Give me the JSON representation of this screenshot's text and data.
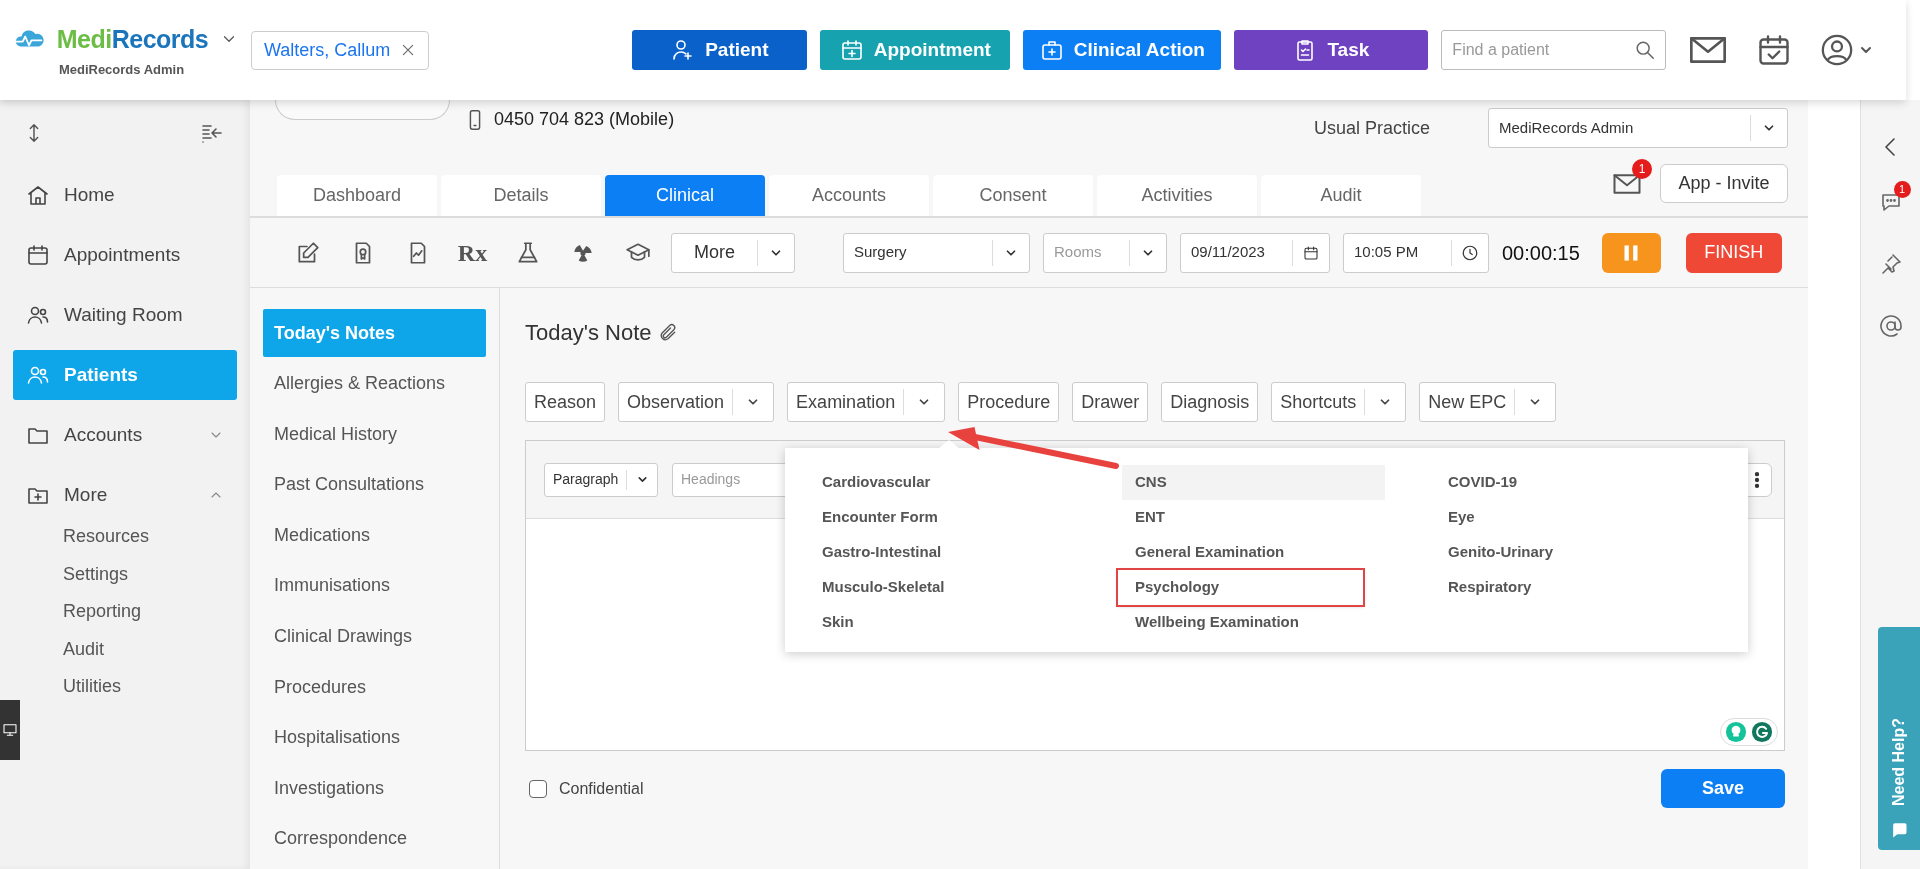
{
  "header": {
    "brand_parts": [
      "Medi",
      "Records"
    ],
    "practice": "MediRecords Admin",
    "patient_chip": "Walters, Callum",
    "actions": [
      {
        "kind": "patient",
        "label": "Patient"
      },
      {
        "kind": "appointment",
        "label": "Appointment"
      },
      {
        "kind": "clinical",
        "label": "Clinical Action"
      },
      {
        "kind": "task",
        "label": "Task"
      }
    ],
    "search": {
      "placeholder": "Find a patient"
    }
  },
  "sidebar": {
    "items": [
      {
        "kind": "link",
        "label": "Home",
        "selected": false
      },
      {
        "kind": "link",
        "label": "Appointments",
        "selected": false
      },
      {
        "kind": "link",
        "label": "Waiting Room",
        "selected": false
      },
      {
        "kind": "link",
        "label": "Patients",
        "selected": true
      },
      {
        "kind": "group",
        "label": "Accounts",
        "selected": false,
        "expanded": false
      },
      {
        "kind": "group",
        "label": "More",
        "selected": false,
        "expanded": true,
        "children": [
          {
            "label": "Resources",
            "selected": false
          },
          {
            "label": "Settings",
            "selected": false
          },
          {
            "label": "Reporting",
            "selected": false
          },
          {
            "label": "Audit",
            "selected": false
          },
          {
            "label": "Utilities",
            "selected": false
          }
        ]
      }
    ]
  },
  "patient": {
    "phone": "0450 704 823 (Mobile)",
    "usual_practice_label": "Usual Practice",
    "usual_practice": "MediRecords Admin",
    "messages_count": "1",
    "invite_button": "App - Invite"
  },
  "tabs": [
    {
      "label": "Dashboard",
      "selected": false
    },
    {
      "label": "Details",
      "selected": false
    },
    {
      "label": "Clinical",
      "selected": true
    },
    {
      "label": "Accounts",
      "selected": false
    },
    {
      "label": "Consent",
      "selected": false
    },
    {
      "label": "Activities",
      "selected": false
    },
    {
      "label": "Audit",
      "selected": false
    }
  ],
  "toolbar": {
    "prescription_label": "Rx",
    "more_button": "More",
    "location": "Surgery",
    "rooms_placeholder": "Rooms",
    "date": "09/11/2023",
    "time": "10:05 PM",
    "timer": "00:00:15",
    "finish_button": "FINISH"
  },
  "notes_nav": {
    "items": [
      {
        "label": "Today's Notes",
        "selected": true
      },
      {
        "label": "Allergies & Reactions",
        "selected": false
      },
      {
        "label": "Medical History",
        "selected": false
      },
      {
        "label": "Past Consultations",
        "selected": false
      },
      {
        "label": "Medications",
        "selected": false
      },
      {
        "label": "Immunisations",
        "selected": false
      },
      {
        "label": "Clinical Drawings",
        "selected": false
      },
      {
        "label": "Procedures",
        "selected": false
      },
      {
        "label": "Hospitalisations",
        "selected": false
      },
      {
        "label": "Investigations",
        "selected": false
      },
      {
        "label": "Correspondence",
        "selected": false
      }
    ]
  },
  "note": {
    "title": "Today's Note",
    "buttons": [
      {
        "kind": "plain",
        "label": "Reason"
      },
      {
        "kind": "split",
        "label": "Observation"
      },
      {
        "kind": "split",
        "label": "Examination"
      },
      {
        "kind": "plain",
        "label": "Procedure"
      },
      {
        "kind": "plain",
        "label": "Drawer"
      },
      {
        "kind": "plain",
        "label": "Diagnosis"
      },
      {
        "kind": "split",
        "label": "Shortcuts"
      },
      {
        "kind": "split",
        "label": "New EPC"
      }
    ],
    "editor": {
      "block_format": "Paragraph",
      "headings_placeholder": "Headings"
    },
    "menu": {
      "columns": [
        [
          {
            "label": "Cardiovascular",
            "hovered": false,
            "outlined": false
          },
          {
            "label": "Encounter Form",
            "hovered": false,
            "outlined": false
          },
          {
            "label": "Gastro-Intestinal",
            "hovered": false,
            "outlined": false
          },
          {
            "label": "Musculo-Skeletal",
            "hovered": false,
            "outlined": false
          },
          {
            "label": "Skin",
            "hovered": false,
            "outlined": false
          }
        ],
        [
          {
            "label": "CNS",
            "hovered": true,
            "outlined": false
          },
          {
            "label": "ENT",
            "hovered": false,
            "outlined": false
          },
          {
            "label": "General Examination",
            "hovered": false,
            "outlined": false
          },
          {
            "label": "Psychology",
            "hovered": false,
            "outlined": true
          },
          {
            "label": "Wellbeing Examination",
            "hovered": false,
            "outlined": false
          }
        ],
        [
          {
            "label": "COVID-19",
            "hovered": false,
            "outlined": false
          },
          {
            "label": "Eye",
            "hovered": false,
            "outlined": false
          },
          {
            "label": "Genito-Urinary",
            "hovered": false,
            "outlined": false
          },
          {
            "label": "Respiratory",
            "hovered": false,
            "outlined": false
          }
        ]
      ]
    },
    "confidential": {
      "label": "Confidential",
      "checked": false
    },
    "save_button": "Save"
  },
  "rail": {
    "chat_count": "1",
    "help_tab": "Need Help?"
  }
}
